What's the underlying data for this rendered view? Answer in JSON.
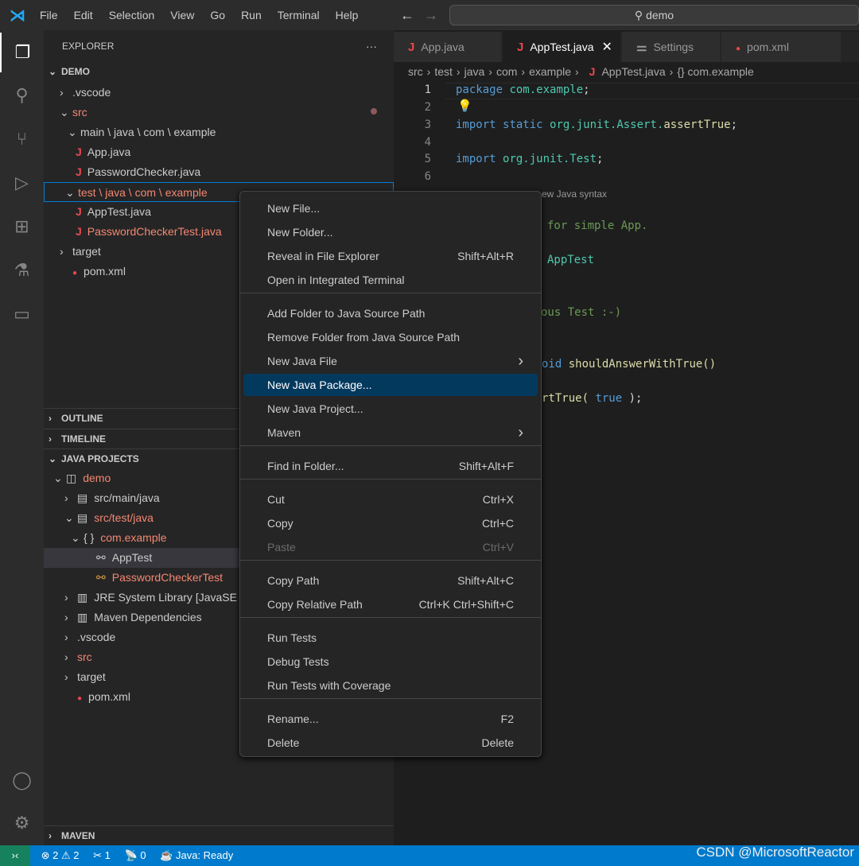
{
  "menubar": [
    "File",
    "Edit",
    "Selection",
    "View",
    "Go",
    "Run",
    "Terminal",
    "Help"
  ],
  "search": "demo",
  "explorer": {
    "title": "EXPLORER",
    "more": "···",
    "root": "DEMO",
    "items": [
      ".vscode",
      "src",
      "main \\ java \\ com \\ example",
      "App.java",
      "PasswordChecker.java",
      "test \\ java \\ com \\ example",
      "AppTest.java",
      "PasswordCheckerTest.java",
      "target",
      "pom.xml"
    ]
  },
  "sections": {
    "outline": "OUTLINE",
    "timeline": "TIMELINE",
    "java_projects": "JAVA PROJECTS",
    "maven": "MAVEN"
  },
  "java_projects": [
    "demo",
    "src/main/java",
    "src/test/java",
    "com.example",
    "AppTest",
    "PasswordCheckerTest",
    "JRE System Library [JavaSE",
    "Maven Dependencies",
    ".vscode",
    "src",
    "target",
    "pom.xml"
  ],
  "tabs": [
    "App.java",
    "AppTest.java",
    "Settings",
    "pom.xml"
  ],
  "breadcrumb": [
    "src",
    "test",
    "java",
    "com",
    "example",
    "AppTest.java",
    "{} com.example"
  ],
  "code": {
    "line_numbers": [
      "1",
      "2",
      "3",
      "4",
      "5",
      "6"
    ],
    "l1": [
      "package",
      "com.example",
      ";"
    ],
    "l3": [
      "import",
      "static",
      "org.junit.Assert.",
      "assertTrue",
      ";"
    ],
    "l5": [
      "import",
      "org.junit.Test",
      ";"
    ],
    "fragments": [
      "ew Java syntax",
      "for simple App.",
      "AppTest",
      "ous Test :-)",
      "oid",
      "shouldAnswerWithTrue()",
      "rtTrue(",
      "true",
      ");"
    ]
  },
  "context_menu": [
    {
      "label": "New File...",
      "shortcut": ""
    },
    {
      "label": "New Folder...",
      "shortcut": ""
    },
    {
      "label": "Reveal in File Explorer",
      "shortcut": "Shift+Alt+R"
    },
    {
      "label": "Open in Integrated Terminal",
      "shortcut": ""
    },
    {
      "label": "Add Folder to Java Source Path",
      "shortcut": ""
    },
    {
      "label": "Remove Folder from Java Source Path",
      "shortcut": ""
    },
    {
      "label": "New Java File",
      "shortcut": "›"
    },
    {
      "label": "New Java Package...",
      "shortcut": ""
    },
    {
      "label": "New Java Project...",
      "shortcut": ""
    },
    {
      "label": "Maven",
      "shortcut": "›"
    },
    {
      "label": "Find in Folder...",
      "shortcut": "Shift+Alt+F"
    },
    {
      "label": "Cut",
      "shortcut": "Ctrl+X"
    },
    {
      "label": "Copy",
      "shortcut": "Ctrl+C"
    },
    {
      "label": "Paste",
      "shortcut": "Ctrl+V"
    },
    {
      "label": "Copy Path",
      "shortcut": "Shift+Alt+C"
    },
    {
      "label": "Copy Relative Path",
      "shortcut": "Ctrl+K Ctrl+Shift+C"
    },
    {
      "label": "Run Tests",
      "shortcut": ""
    },
    {
      "label": "Debug Tests",
      "shortcut": ""
    },
    {
      "label": "Run Tests with Coverage",
      "shortcut": ""
    },
    {
      "label": "Rename...",
      "shortcut": "F2"
    },
    {
      "label": "Delete",
      "shortcut": "Delete"
    }
  ],
  "status": {
    "errors": "2",
    "warnings": "2",
    "tools": "1",
    "ports": "0",
    "java": "Java: Ready"
  },
  "watermark": "CSDN @MicrosoftReactor",
  "colors": {
    "accent": "#007acc",
    "selection": "#04395e",
    "error_text": "#f48771"
  }
}
